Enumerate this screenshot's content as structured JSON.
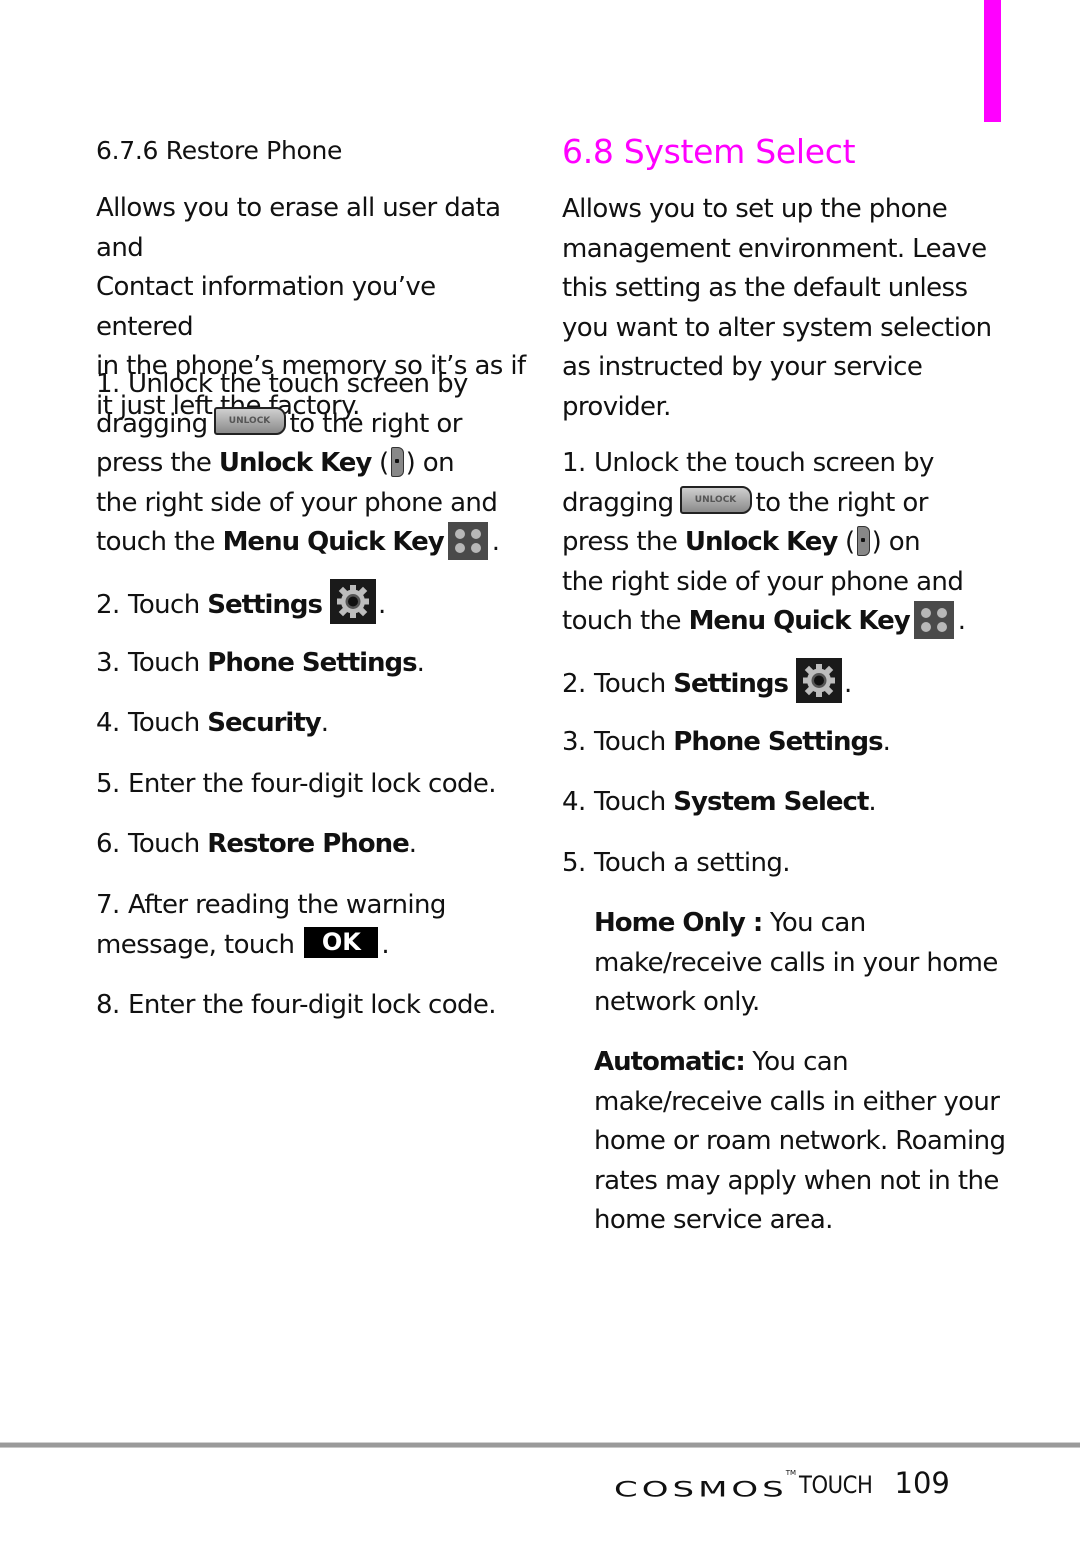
{
  "accent_color": "#ff00ff",
  "left": {
    "heading": "6.7.6 Restore Phone",
    "intro": "Allows you to erase all user data and Contact information you’ve entered in the phone’s memory so it’s as if it just left the factory.",
    "intro_lines": [
      "Allows you to erase all user data and",
      "Contact information you’ve entered",
      "in the phone’s memory so it’s as if",
      "it just left the factory."
    ],
    "steps": {
      "s1": {
        "num": "1.",
        "l1": "Unlock the touch screen by",
        "l2a": "dragging",
        "l2b": "to the right or",
        "l3a": "press the",
        "l3b": "Unlock Key",
        "l3c": "(",
        "l3d": ") on",
        "l4": "the right side of your phone and",
        "l5a": "touch the",
        "l5b": "Menu Quick Key",
        "l5c": "."
      },
      "s2": {
        "num": "2.",
        "a": "Touch",
        "b": "Settings",
        "c": "."
      },
      "s3": {
        "num": "3.",
        "a": "Touch",
        "b": "Phone Settings",
        "c": "."
      },
      "s4": {
        "num": "4.",
        "a": "Touch",
        "b": "Security",
        "c": "."
      },
      "s5": {
        "num": "5.",
        "a": "Enter the four-digit lock code."
      },
      "s6": {
        "num": "6.",
        "a": "Touch",
        "b": "Restore Phone",
        "c": "."
      },
      "s7": {
        "num": "7.",
        "l1": "After reading the warning",
        "l2a": "message, touch",
        "ok": "OK",
        "l2c": "."
      },
      "s8": {
        "num": "8.",
        "a": "Enter the four-digit lock code."
      }
    }
  },
  "right": {
    "heading": "6.8 System Select",
    "intro_lines": [
      "Allows you to set up the phone",
      "management environment. Leave",
      "this setting as the default unless",
      "you want to alter system selection",
      "as instructed by your service",
      "provider."
    ],
    "steps": {
      "s1": {
        "num": "1.",
        "l1": "Unlock the touch screen by",
        "l2a": "dragging",
        "l2b": "to the right or",
        "l3a": "press the",
        "l3b": "Unlock Key",
        "l3c": "(",
        "l3d": ") on",
        "l4": "the right side of your phone and",
        "l5a": "touch the",
        "l5b": "Menu Quick Key",
        "l5c": "."
      },
      "s2": {
        "num": "2.",
        "a": "Touch",
        "b": "Settings",
        "c": "."
      },
      "s3": {
        "num": "3.",
        "a": "Touch",
        "b": "Phone Settings",
        "c": "."
      },
      "s4": {
        "num": "4.",
        "a": "Touch",
        "b": "System Select",
        "c": "."
      },
      "s5": {
        "num": "5.",
        "a": "Touch a setting."
      }
    },
    "options": {
      "home_only": {
        "label": "Home Only :",
        "lines": [
          "You can",
          "make/receive calls in your home",
          "network only."
        ]
      },
      "automatic": {
        "label": "Automatic:",
        "lines": [
          "You can",
          "make/receive calls in either your",
          "home or roam network. Roaming",
          "rates may apply when not in the",
          "home service area."
        ]
      }
    }
  },
  "icons": {
    "unlock_slider_text": "UNLOCK",
    "unlock_slider": "unlock-slider-icon",
    "unlock_key": "unlock-key-icon",
    "menu_quick_key": "menu-grid-icon",
    "settings": "gear-icon"
  },
  "footer": {
    "brand": "COSMOS",
    "trademark": "TM",
    "product": "TOUCH",
    "page_number": "109"
  }
}
